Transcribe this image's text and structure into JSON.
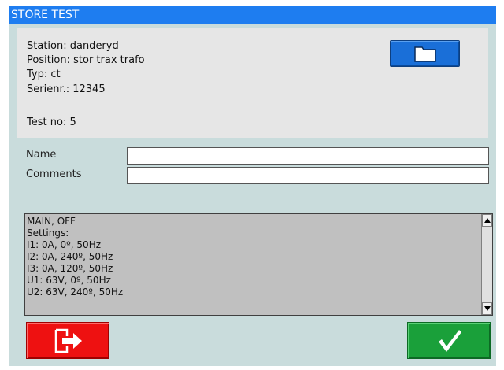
{
  "window": {
    "title": "STORE TEST"
  },
  "info": {
    "station": "Station: danderyd",
    "position": "Position: stor trax trafo",
    "typ": "Typ: ct",
    "serial": "Serienr.: 12345",
    "test_no": "Test no: 5"
  },
  "form": {
    "name_label": "Name",
    "name_value": "",
    "comments_label": "Comments",
    "comments_value": ""
  },
  "settings_list": {
    "lines": [
      "MAIN, OFF",
      "Settings:",
      "I1: 0A, 0º, 50Hz",
      "I2: 0A, 240º, 50Hz",
      "I3: 0A, 120º, 50Hz",
      "U1: 63V, 0º, 50Hz",
      "U2: 63V, 240º, 50Hz"
    ]
  },
  "icons": {
    "folder": "folder-icon",
    "exit": "exit-door-icon",
    "confirm": "checkmark-icon"
  },
  "colors": {
    "titlebar": "#1e7df0",
    "folder_button": "#1a6fd8",
    "exit_button": "#ee1111",
    "ok_button": "#1aa03a",
    "background": "#c9dcdc"
  }
}
